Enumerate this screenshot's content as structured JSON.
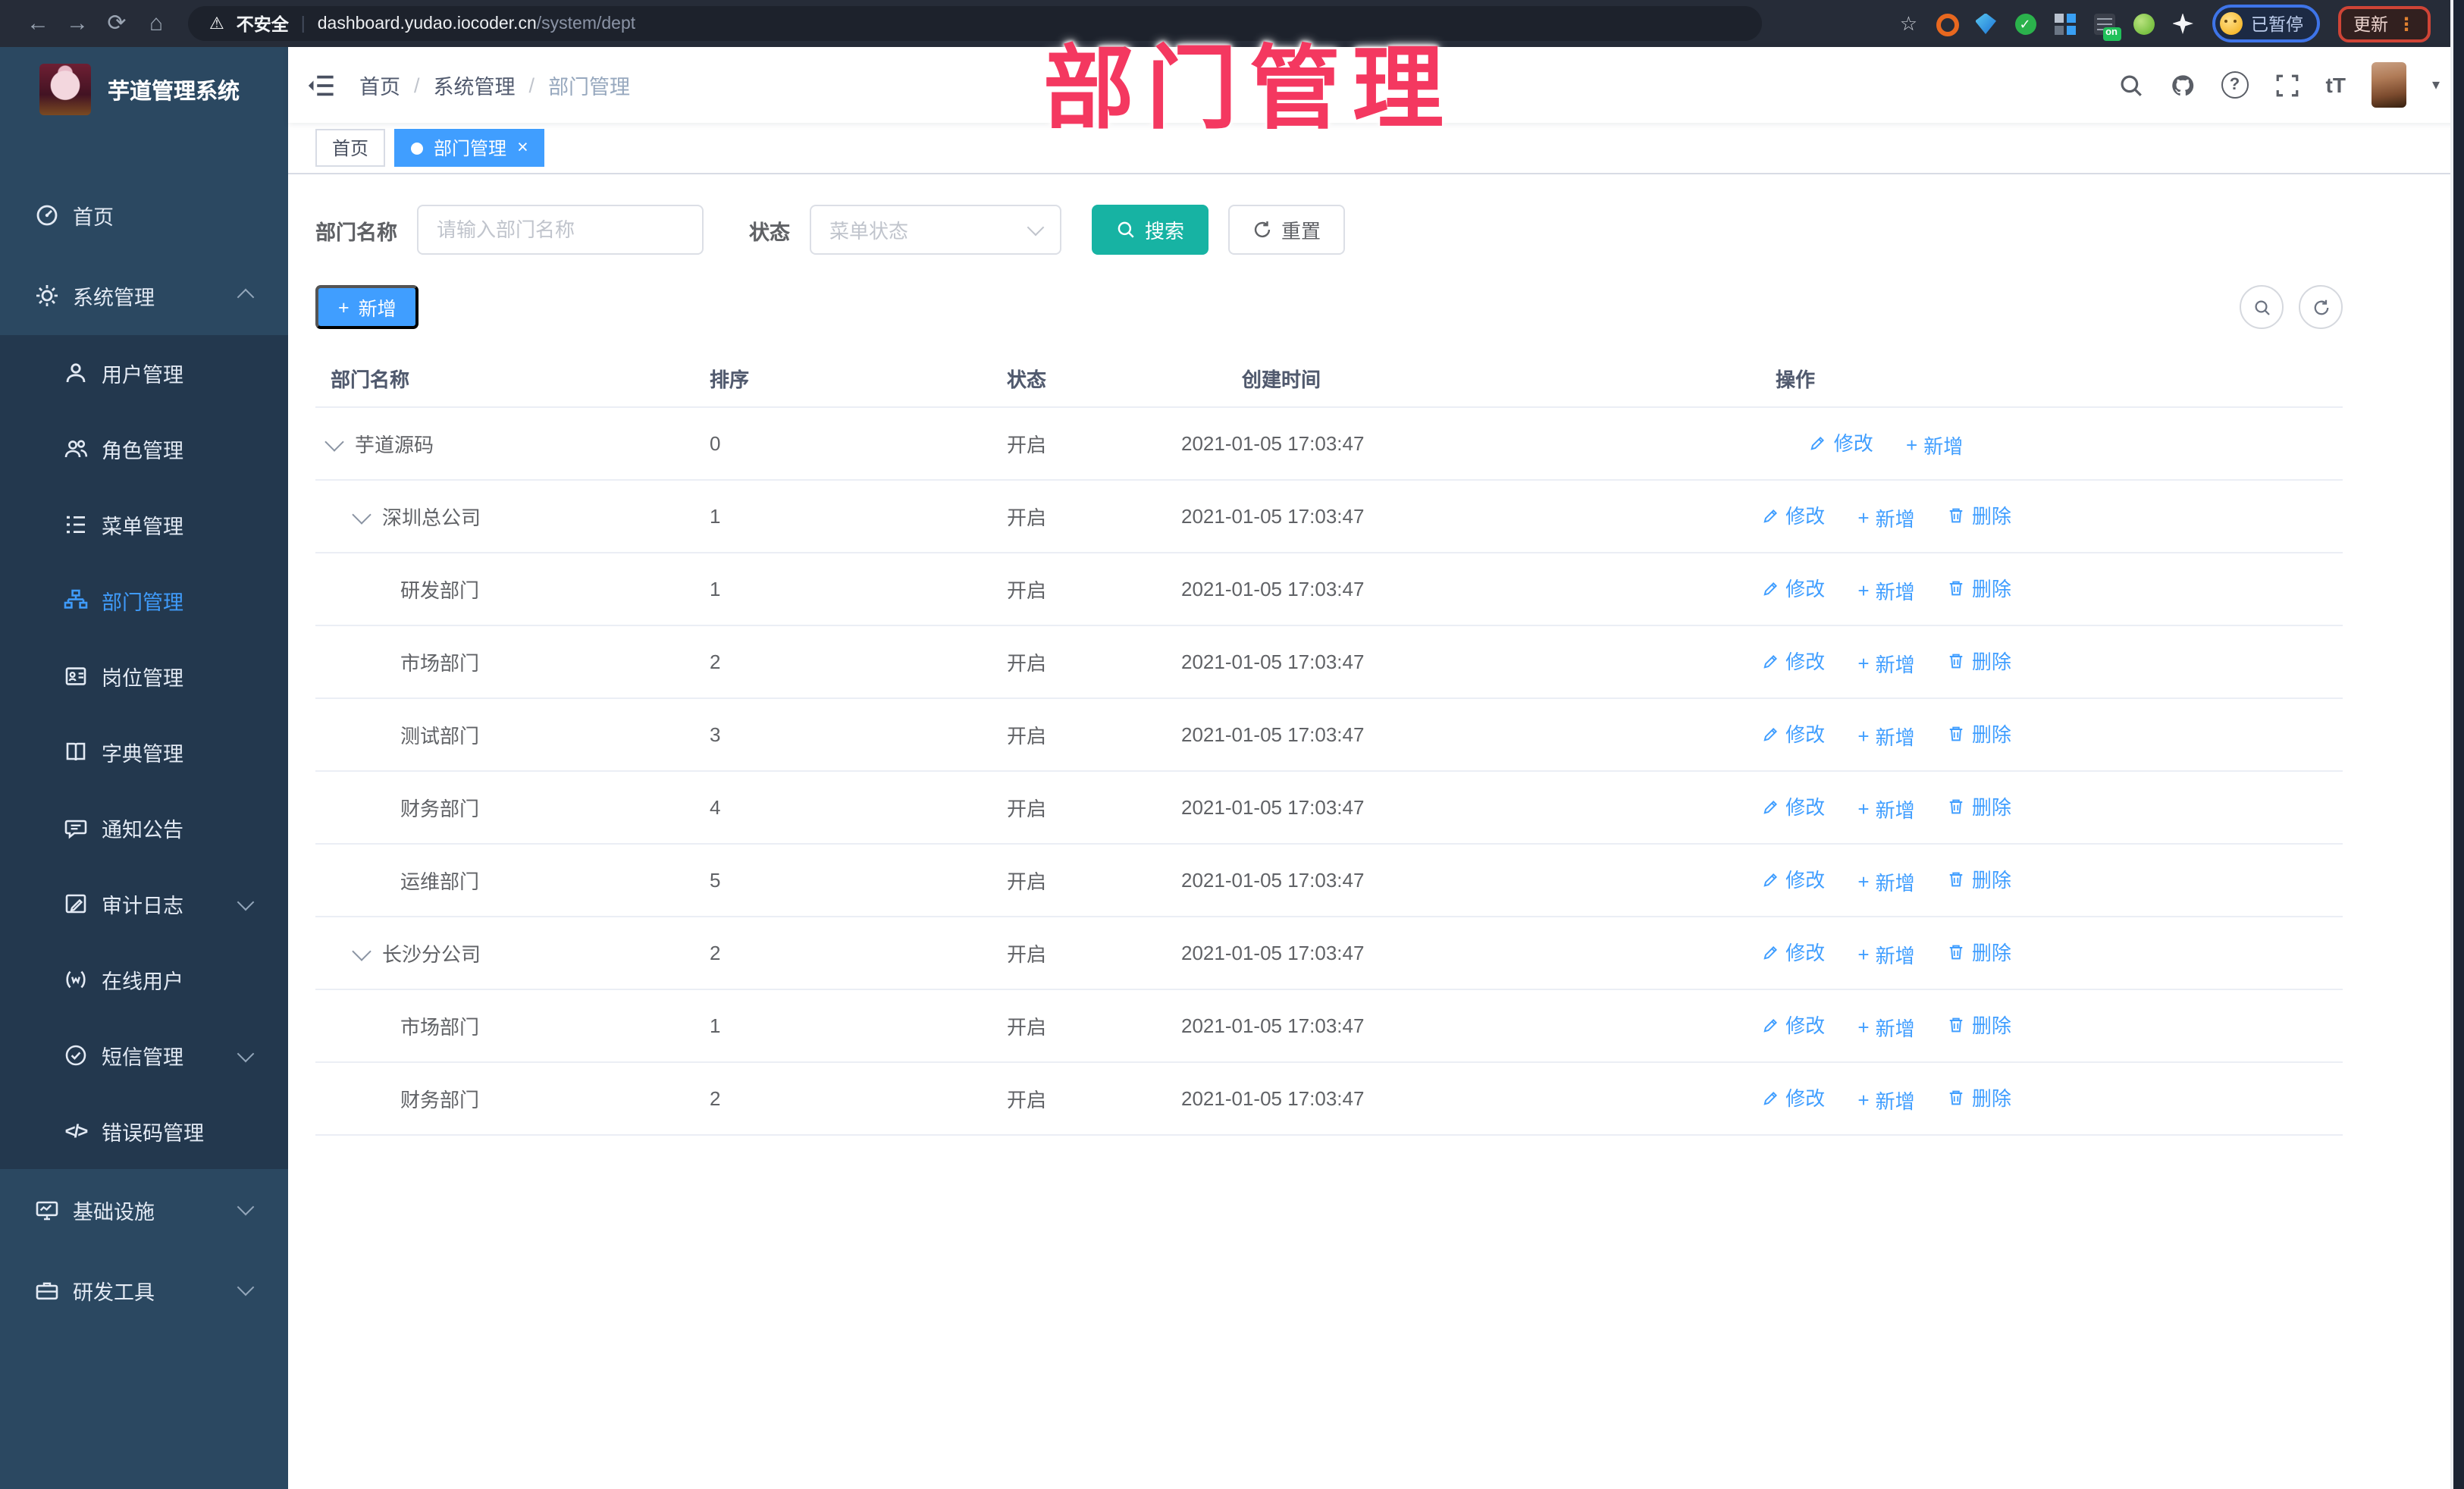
{
  "browser": {
    "security_label": "不安全",
    "url_host": "dashboard.yudao.iocoder.cn",
    "url_path": "/system/dept",
    "paused_label": "已暂停",
    "update_label": "更新",
    "ext_badge": "on"
  },
  "icons": {
    "back": "←",
    "forward": "→",
    "reload": "⟳",
    "home": "⌂",
    "warning": "⚠",
    "pipe": "|",
    "star": "☆",
    "check": "✓",
    "more_dots": "⋮",
    "caret_down": "▾",
    "slash": "/",
    "close": "×",
    "plus": "+",
    "question": "?",
    "font_size": "tT",
    "code": "</>"
  },
  "watermark": "部门管理",
  "sidebar": {
    "title": "芋道管理系统",
    "items": [
      {
        "label": "首页"
      },
      {
        "label": "系统管理"
      },
      {
        "label": "用户管理"
      },
      {
        "label": "角色管理"
      },
      {
        "label": "菜单管理"
      },
      {
        "label": "部门管理"
      },
      {
        "label": "岗位管理"
      },
      {
        "label": "字典管理"
      },
      {
        "label": "通知公告"
      },
      {
        "label": "审计日志"
      },
      {
        "label": "在线用户"
      },
      {
        "label": "短信管理"
      },
      {
        "label": "错误码管理"
      },
      {
        "label": "基础设施"
      },
      {
        "label": "研发工具"
      }
    ]
  },
  "header": {
    "breadcrumb": [
      "首页",
      "系统管理",
      "部门管理"
    ]
  },
  "tabs": [
    {
      "label": "首页"
    },
    {
      "label": "部门管理"
    }
  ],
  "filters": {
    "name_label": "部门名称",
    "name_placeholder": "请输入部门名称",
    "status_label": "状态",
    "status_placeholder": "菜单状态",
    "search_label": "搜索",
    "reset_label": "重置"
  },
  "toolbar": {
    "add_label": "新增"
  },
  "table": {
    "columns": [
      "部门名称",
      "排序",
      "状态",
      "创建时间",
      "操作"
    ],
    "action_labels": {
      "edit": "修改",
      "add": "新增",
      "delete": "删除"
    },
    "rows": [
      {
        "name": "芋道源码",
        "sort": "0",
        "status": "开启",
        "created": "2021-01-05 17:03:47"
      },
      {
        "name": "深圳总公司",
        "sort": "1",
        "status": "开启",
        "created": "2021-01-05 17:03:47"
      },
      {
        "name": "研发部门",
        "sort": "1",
        "status": "开启",
        "created": "2021-01-05 17:03:47"
      },
      {
        "name": "市场部门",
        "sort": "2",
        "status": "开启",
        "created": "2021-01-05 17:03:47"
      },
      {
        "name": "测试部门",
        "sort": "3",
        "status": "开启",
        "created": "2021-01-05 17:03:47"
      },
      {
        "name": "财务部门",
        "sort": "4",
        "status": "开启",
        "created": "2021-01-05 17:03:47"
      },
      {
        "name": "运维部门",
        "sort": "5",
        "status": "开启",
        "created": "2021-01-05 17:03:47"
      },
      {
        "name": "长沙分公司",
        "sort": "2",
        "status": "开启",
        "created": "2021-01-05 17:03:47"
      },
      {
        "name": "市场部门",
        "sort": "1",
        "status": "开启",
        "created": "2021-01-05 17:03:47"
      },
      {
        "name": "财务部门",
        "sort": "2",
        "status": "开启",
        "created": "2021-01-05 17:03:47"
      }
    ]
  },
  "colors": {
    "accent_blue": "#409eff",
    "teal": "#17b3a3",
    "sidebar_bg": "#2b4861",
    "submenu_bg": "#23384e",
    "watermark_pink": "#f43860",
    "chrome_bg": "#262c38"
  }
}
